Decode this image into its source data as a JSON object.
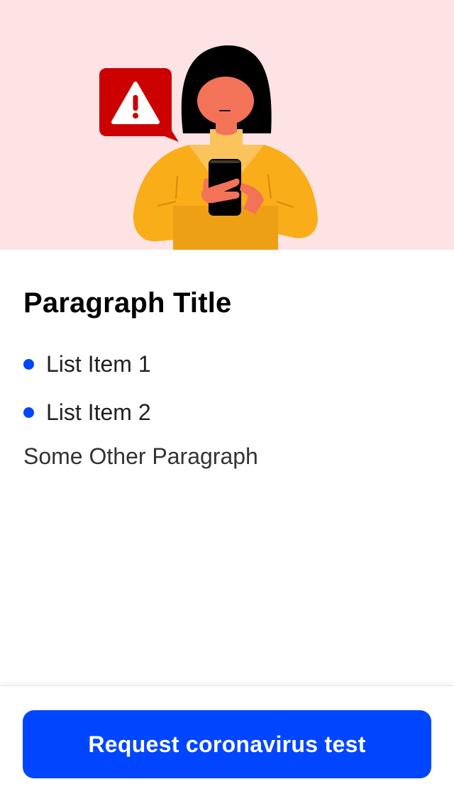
{
  "hero": {
    "illustration": "woman-with-phone-warning",
    "alert_icon": "warning-triangle-icon",
    "background": "#fde3e4",
    "alert_color": "#cc0000"
  },
  "content": {
    "title": "Paragraph Title",
    "list_items": [
      {
        "label": "List Item 1"
      },
      {
        "label": "List Item 2"
      }
    ],
    "paragraph": "Some Other Paragraph",
    "bullet_color": "#0046ff"
  },
  "footer": {
    "button_label": "Request coronavirus test",
    "button_color": "#0046ff"
  }
}
